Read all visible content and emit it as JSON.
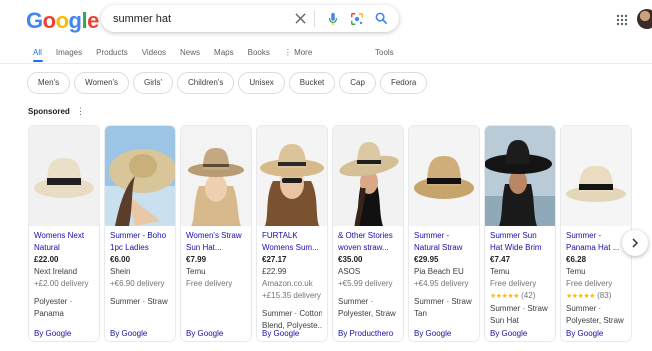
{
  "logo": {
    "letters": [
      "G",
      "o",
      "o",
      "g",
      "l",
      "e"
    ],
    "colors": [
      "#4285f4",
      "#ea4335",
      "#fbbc05",
      "#4285f4",
      "#34a853",
      "#ea4335"
    ]
  },
  "search": {
    "query": "summer hat"
  },
  "icons": {
    "clear": "close-icon",
    "voice": "microphone-icon",
    "lens": "camera-lens-icon",
    "search": "search-icon",
    "apps": "apps-grid-icon"
  },
  "tabs": {
    "items": [
      "All",
      "Images",
      "Products",
      "Videos",
      "News",
      "Maps",
      "Books",
      "⋮ More"
    ],
    "tools": "Tools"
  },
  "chips": [
    "Men's",
    "Women's",
    "Girls'",
    "Children's",
    "Unisex",
    "Bucket",
    "Cap",
    "Fedora"
  ],
  "sponsored": {
    "label": "Sponsored",
    "menu": "⋮"
  },
  "products": [
    {
      "title": "Womens Next Natural Panam...",
      "price": "£22.00",
      "store": "Next Ireland",
      "shipping": "+£2.00 delivery",
      "rating": "",
      "reviews": "",
      "attr1": "Polyester ·",
      "attr2": "Panama",
      "footer": "By Google"
    },
    {
      "title": "Summer - Boho 1pc Ladies Bea...",
      "price": "€6.00",
      "store": "Shein",
      "shipping": "+€6.90 delivery",
      "rating": "",
      "reviews": "",
      "attr1": "Summer · Straw",
      "attr2": "",
      "footer": "By Google"
    },
    {
      "title": "Women's Straw Sun Hat...",
      "price": "€7.99",
      "store": "Temu",
      "shipping": "Free delivery",
      "rating": "",
      "reviews": "",
      "attr1": "",
      "attr2": "",
      "footer": "By Google"
    },
    {
      "title": "FURTALK Womens Sum...",
      "price": "€27.17",
      "store": "£22.99",
      "shipping": "Amazon.co.uk",
      "extra": "+£15.35 delivery",
      "rating": "",
      "reviews": "",
      "attr1": "Summer · Cotton",
      "attr2": "Blend, Polyeste...",
      "footer": "By Google"
    },
    {
      "title": "& Other Stories woven straw...",
      "price": "€35.00",
      "store": "ASOS",
      "shipping": "+€5.99 delivery",
      "rating": "",
      "reviews": "",
      "attr1": "Summer ·",
      "attr2": "Polyester, Straw",
      "footer": "By Producthero"
    },
    {
      "title": "Summer - Natural Straw Fedora ...",
      "price": "€29.95",
      "store": "Pia Beach EU",
      "shipping": "+€4.95 delivery",
      "rating": "",
      "reviews": "",
      "attr1": "Summer · Straw ·",
      "attr2": "Tan",
      "footer": "By Google"
    },
    {
      "title": "Summer Sun Hat Wide Brim Soli...",
      "price": "€7.47",
      "store": "Temu",
      "shipping": "Free delivery",
      "rating": "★★★★★",
      "reviews": "(42)",
      "attr1": "Summer · Straw ·",
      "attr2": "Sun Hat",
      "footer": "By Google"
    },
    {
      "title": "Summer - Panama Hat ...",
      "price": "€6.28",
      "store": "Temu",
      "shipping": "Free delivery",
      "rating": "★★★★★",
      "reviews": "(83)",
      "attr1": "Summer ·",
      "attr2": "Polyester, Straw",
      "footer": "By Google"
    }
  ],
  "accent": {
    "link": "#1a0dab",
    "active_tab": "#1a73e8",
    "star": "#fbbc04"
  }
}
